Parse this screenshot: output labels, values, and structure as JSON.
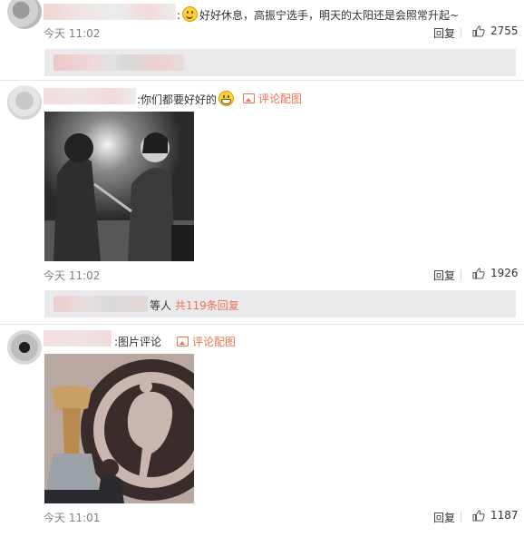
{
  "comments": [
    {
      "text": "好好休息，高振宁选手，明天的太阳还是会照常升起~",
      "time": "今天 11:02",
      "reply_label": "回复",
      "likes": "2755",
      "sub_reply_text": ""
    },
    {
      "text": "你们都要好好的",
      "pic_link": "评论配图",
      "time": "今天 11:02",
      "reply_label": "回复",
      "likes": "1926",
      "sub_reply_prefix": "等人",
      "sub_reply_link": "共119条回复"
    },
    {
      "text": "图片评论",
      "pic_link": "评论配图",
      "time": "今天 11:01",
      "reply_label": "回复",
      "likes": "1187"
    }
  ],
  "colors": {
    "link": "#eb7350",
    "muted": "#808080",
    "subbox": "#eaeaec"
  },
  "icons": [
    "avatar",
    "smile-emoji-icon",
    "grin-emoji-icon",
    "image-icon",
    "thumbs-up-icon"
  ]
}
